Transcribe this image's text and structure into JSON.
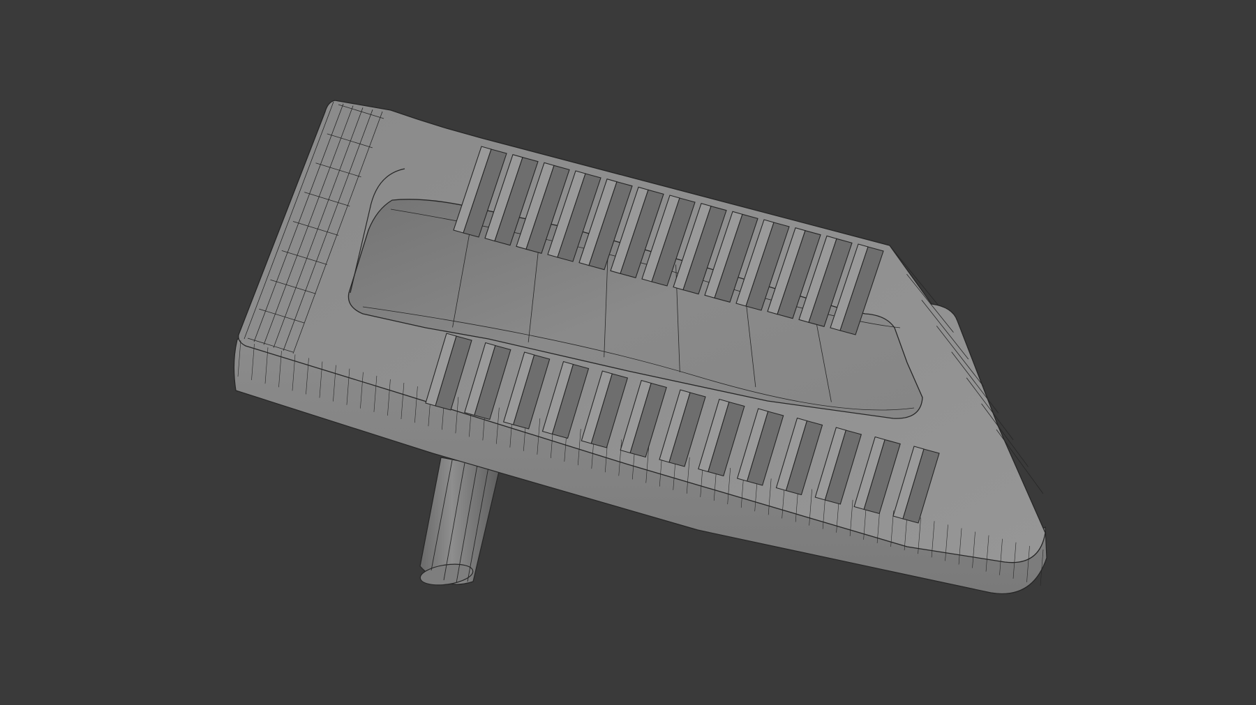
{
  "viewport": {
    "background_color": "#3a3a3a",
    "shading": "solid-gray-with-wireframe",
    "mesh_color": "#8e8e8e",
    "wire_color": "#262626"
  },
  "object": {
    "subject": "squat-toilet-pan",
    "parts": [
      "rim",
      "bowl",
      "left-foot-grip",
      "right-foot-grip",
      "drain-pipe"
    ],
    "ridges_per_grip": 13
  }
}
